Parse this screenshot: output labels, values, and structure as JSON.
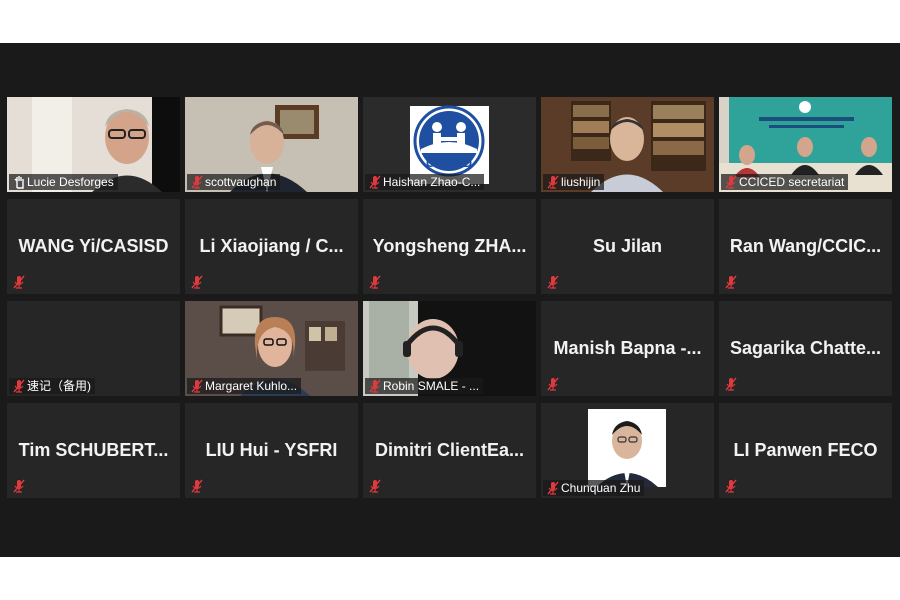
{
  "meeting": {
    "tiles": [
      {
        "name": "Lucie Desforges",
        "video": true,
        "active": true,
        "muted": false
      },
      {
        "name": "scottvaughan",
        "video": true,
        "muted": true
      },
      {
        "name": "Haishan Zhao-C...",
        "video": true,
        "muted": true,
        "logo_text": "CCICED"
      },
      {
        "name": "liushijin",
        "video": true,
        "muted": true
      },
      {
        "name": "CCICED secretariat",
        "video": true,
        "muted": true
      },
      {
        "name": "WANG Yi/CASISD",
        "video": false,
        "muted": true
      },
      {
        "name": "Li Xiaojiang / C...",
        "video": false,
        "muted": true
      },
      {
        "name": "Yongsheng  ZHA...",
        "video": false,
        "muted": true
      },
      {
        "name": "Su Jilan",
        "video": false,
        "muted": true
      },
      {
        "name": "Ran  Wang/CCIC...",
        "video": false,
        "muted": true
      },
      {
        "name": "速记（备用)",
        "video": false,
        "muted": true,
        "show_label": true
      },
      {
        "name": "Margaret Kuhlo...",
        "video": true,
        "muted": true
      },
      {
        "name": "Robin SMALE - ...",
        "video": true,
        "muted": true
      },
      {
        "name": "Manish  Bapna -...",
        "video": false,
        "muted": true
      },
      {
        "name": "Sagarika  Chatte...",
        "video": false,
        "muted": true
      },
      {
        "name": "Tim  SCHUBERT...",
        "video": false,
        "muted": true
      },
      {
        "name": "LIU Hui - YSFRI",
        "video": false,
        "muted": true
      },
      {
        "name": "Dimitri  ClientEa...",
        "video": false,
        "muted": true
      },
      {
        "name": "Chunquan Zhu",
        "video": true,
        "muted": true
      },
      {
        "name": "LI Panwen FECO",
        "video": false,
        "muted": true
      }
    ]
  },
  "colors": {
    "active_border": "#d8f06a",
    "muted_icon": "#e0393e",
    "tile_bg": "#262626",
    "meeting_bg": "#1a1a1a"
  }
}
